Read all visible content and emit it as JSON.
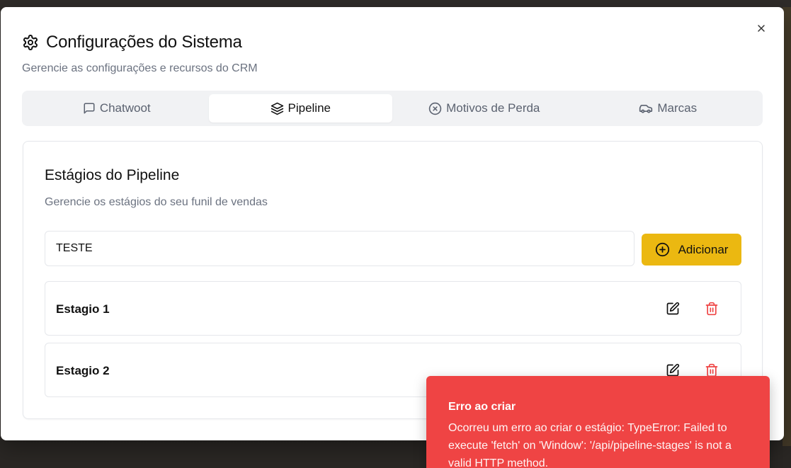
{
  "dialog": {
    "title": "Configurações do Sistema",
    "subtitle": "Gerencie as configurações e recursos do CRM",
    "title_icon": "gear-icon",
    "close_icon": "close-icon"
  },
  "tabs": [
    {
      "label": "Chatwoot",
      "icon": "message-square-icon",
      "active": false
    },
    {
      "label": "Pipeline",
      "icon": "layers-icon",
      "active": true
    },
    {
      "label": "Motivos de Perda",
      "icon": "x-circle-icon",
      "active": false
    },
    {
      "label": "Marcas",
      "icon": "car-icon",
      "active": false
    }
  ],
  "pipeline": {
    "title": "Estágios do Pipeline",
    "description": "Gerencie os estágios do seu funil de vendas",
    "input_value": "TESTE",
    "add_label": "Adicionar",
    "add_icon": "plus-circle-icon",
    "stages": [
      {
        "name": "Estagio 1"
      },
      {
        "name": "Estagio 2"
      }
    ]
  },
  "toast": {
    "title": "Erro ao criar",
    "message": "Ocorreu um erro ao criar o estágio: TypeError: Failed to execute 'fetch' on 'Window': '/api/pipeline-stages' is not a valid HTTP method.",
    "color": "#ef4444"
  },
  "colors": {
    "accent": "#ebb811",
    "danger": "#ef4444"
  }
}
